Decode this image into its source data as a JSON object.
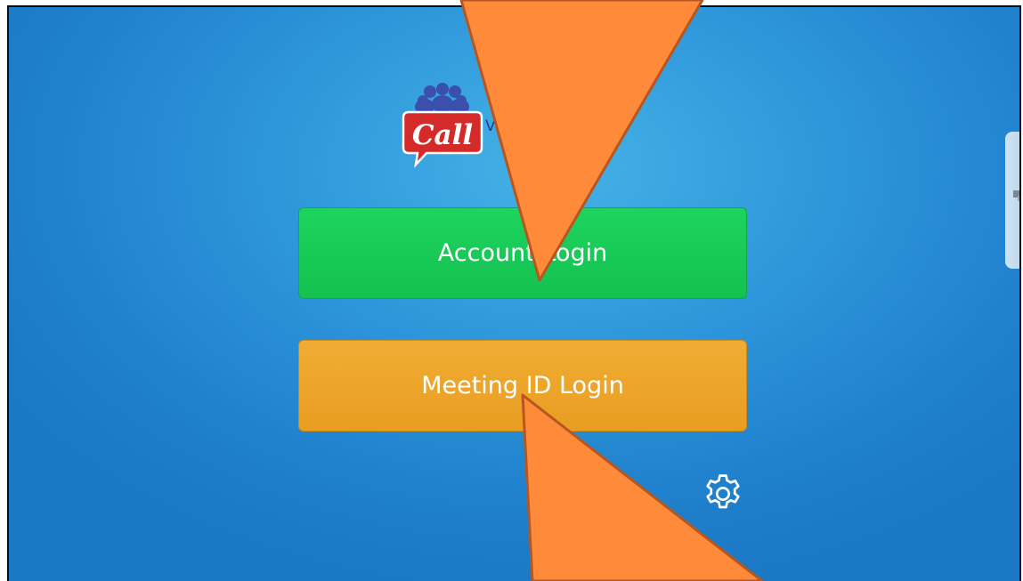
{
  "app": {
    "logo_word": "Call",
    "logo_text": "V            ce"
  },
  "buttons": {
    "account_login": "Account Login",
    "meeting_id_login": "Meeting ID Login"
  },
  "icons": {
    "settings": "gear-icon",
    "logo": "call-people-logo-icon",
    "side_handle": "side-panel-handle"
  },
  "colors": {
    "background": "#2b8fd6",
    "account_button": "#19c958",
    "meeting_button": "#eda42b",
    "annotation_arrow": "#ff8a3a",
    "logo_red": "#d42a2a",
    "logo_blue": "#3b4fae"
  }
}
